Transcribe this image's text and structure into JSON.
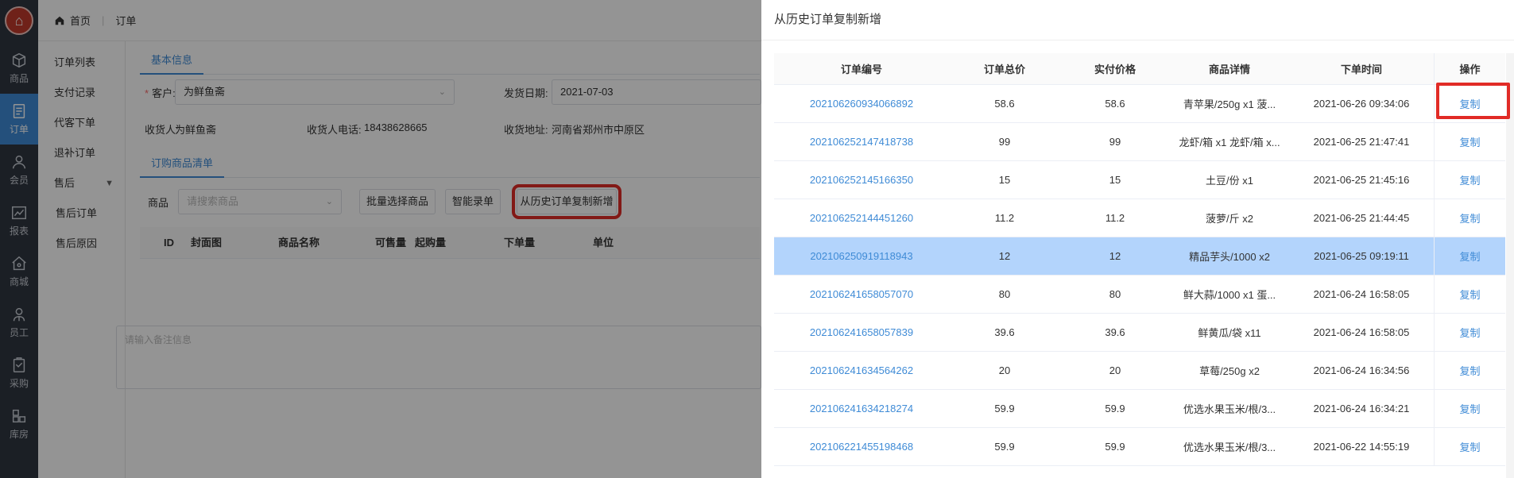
{
  "nav": {
    "items": [
      {
        "label": "商品",
        "icon": "box-icon"
      },
      {
        "label": "订单",
        "icon": "document-icon",
        "active": true
      },
      {
        "label": "会员",
        "icon": "user-icon"
      },
      {
        "label": "报表",
        "icon": "chart-icon"
      },
      {
        "label": "商城",
        "icon": "store-icon"
      },
      {
        "label": "员工",
        "icon": "staff-icon"
      },
      {
        "label": "采购",
        "icon": "clipboard-icon"
      },
      {
        "label": "库房",
        "icon": "warehouse-icon"
      }
    ]
  },
  "submenu": {
    "items": [
      "订单列表",
      "支付记录",
      "代客下单",
      "退补订单",
      "售后",
      "售后订单",
      "售后原因"
    ]
  },
  "header": {
    "home": "首页",
    "current": "订单"
  },
  "form": {
    "tab_basic": "基本信息",
    "customer_label": "客户:",
    "customer_value": "为鲜鱼斋",
    "ship_date_label": "发货日期:",
    "ship_date_value": "2021-07-03",
    "receiver_label": "收货人:",
    "receiver_value": "为鲜鱼斋",
    "phone_label": "收货人电话:",
    "phone_value": "18438628665",
    "address_label": "收货地址:",
    "address_value": "河南省郑州市中原区",
    "tab_items": "订购商品清单",
    "product_label": "商品",
    "product_placeholder": "请搜索商品",
    "batch_button": "批量选择商品",
    "smart_button": "智能录单",
    "copy_history_button": "从历史订单复制新增",
    "table_headers": [
      "ID",
      "封面图",
      "商品名称",
      "可售量",
      "起购量",
      "下单量",
      "单位"
    ],
    "remark_placeholder": "请输入备注信息"
  },
  "drawer": {
    "title": "从历史订单复制新增",
    "columns": [
      "订单编号",
      "订单总价",
      "实付价格",
      "商品详情",
      "下单时间",
      "操作"
    ],
    "action_label": "复制",
    "rows": [
      {
        "no": "202106260934066892",
        "total": "58.6",
        "paid": "58.6",
        "detail": "青苹果/250g x1 菠...",
        "time": "2021-06-26 09:34:06"
      },
      {
        "no": "202106252147418738",
        "total": "99",
        "paid": "99",
        "detail": "龙虾/箱 x1 龙虾/箱 x...",
        "time": "2021-06-25 21:47:41"
      },
      {
        "no": "202106252145166350",
        "total": "15",
        "paid": "15",
        "detail": "土豆/份 x1",
        "time": "2021-06-25 21:45:16"
      },
      {
        "no": "202106252144451260",
        "total": "11.2",
        "paid": "11.2",
        "detail": "菠萝/斤 x2",
        "time": "2021-06-25 21:44:45"
      },
      {
        "no": "202106250919118943",
        "total": "12",
        "paid": "12",
        "detail": "精品芋头/1000 x2",
        "time": "2021-06-25 09:19:11",
        "highlight": true
      },
      {
        "no": "202106241658057070",
        "total": "80",
        "paid": "80",
        "detail": "鲜大蒜/1000 x1 蛋...",
        "time": "2021-06-24 16:58:05"
      },
      {
        "no": "202106241658057839",
        "total": "39.6",
        "paid": "39.6",
        "detail": "鲜黄瓜/袋 x11",
        "time": "2021-06-24 16:58:05"
      },
      {
        "no": "202106241634564262",
        "total": "20",
        "paid": "20",
        "detail": "草莓/250g x2",
        "time": "2021-06-24 16:34:56"
      },
      {
        "no": "202106241634218274",
        "total": "59.9",
        "paid": "59.9",
        "detail": "优选水果玉米/根/3...",
        "time": "2021-06-24 16:34:21"
      },
      {
        "no": "202106221455198468",
        "total": "59.9",
        "paid": "59.9",
        "detail": "优选水果玉米/根/3...",
        "time": "2021-06-22 14:55:19"
      }
    ]
  },
  "colors": {
    "accent": "#3f8bd6",
    "highlight_row": "#b3d4fc",
    "annotation_red": "#e12b26",
    "rail": "#303640"
  }
}
